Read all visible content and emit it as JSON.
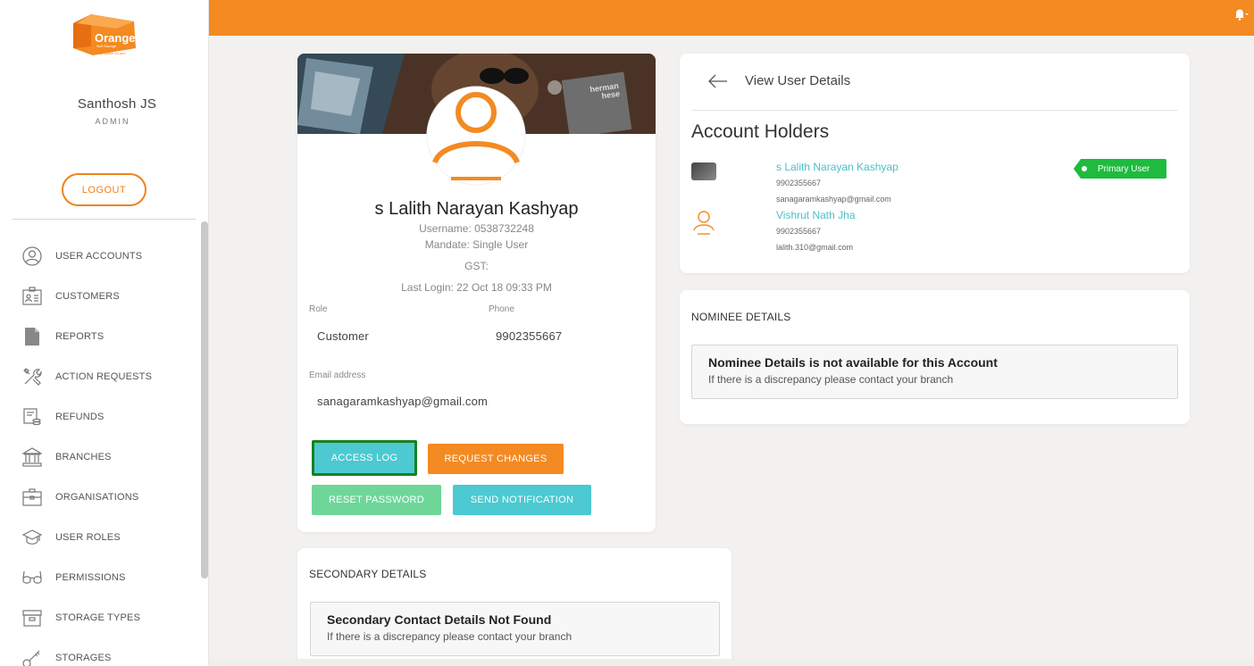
{
  "brand": {
    "logo_text": "Orange",
    "logo_sub": "Self Storage",
    "logo_tag": "Extra space for you",
    "accent": "#f38a22",
    "teal": "#4cc9d1",
    "green": "#1ebb3f"
  },
  "sidebar": {
    "user_name": "Santhosh JS",
    "user_role": "ADMIN",
    "logout_label": "LOGOUT",
    "items": [
      {
        "label": "USER ACCOUNTS",
        "icon": "user-circle-icon"
      },
      {
        "label": "CUSTOMERS",
        "icon": "id-card-icon"
      },
      {
        "label": "REPORTS",
        "icon": "document-icon"
      },
      {
        "label": "ACTION REQUESTS",
        "icon": "tools-icon"
      },
      {
        "label": "REFUNDS",
        "icon": "refund-icon"
      },
      {
        "label": "BRANCHES",
        "icon": "bank-icon"
      },
      {
        "label": "ORGANISATIONS",
        "icon": "briefcase-icon"
      },
      {
        "label": "USER ROLES",
        "icon": "graduation-cap-icon"
      },
      {
        "label": "PERMISSIONS",
        "icon": "glasses-icon"
      },
      {
        "label": "STORAGE TYPES",
        "icon": "archive-box-icon"
      },
      {
        "label": "STORAGES",
        "icon": "key-icon"
      }
    ]
  },
  "profile": {
    "name": "s Lalith Narayan Kashyap",
    "username": "Username: 0538732248",
    "mandate": "Mandate: Single User",
    "gst": "GST:",
    "last_login": "Last Login: 22 Oct 18 09:33 PM",
    "role_label": "Role",
    "role_value": "Customer",
    "phone_label": "Phone",
    "phone_value": "9902355667",
    "email_label": "Email address",
    "email_value": "sanagaramkashyap@gmail.com",
    "buttons": {
      "access_log": "ACCESS LOG",
      "request_changes": "REQUEST CHANGES",
      "reset_password": "RESET PASSWORD",
      "send_notification": "SEND NOTIFICATION"
    }
  },
  "details": {
    "title": "View User Details",
    "account_heading": "Account Holders",
    "holders": [
      {
        "name": "s Lalith Narayan Kashyap",
        "phone": "9902355667",
        "email": "sanagaramkashyap@gmail.com",
        "badge": "Primary User"
      },
      {
        "name": "Vishrut Nath Jha",
        "phone": "9902355667",
        "email": "lalith.310@gmail.com"
      }
    ]
  },
  "nominee": {
    "title": "NOMINEE DETAILS",
    "notice_title": "Nominee Details is not available for this Account",
    "notice_sub": "If there is a discrepancy please contact your branch"
  },
  "secondary": {
    "title": "SECONDARY DETAILS",
    "notice_title": "Secondary Contact Details Not Found",
    "notice_sub": "If there is a discrepancy please contact your branch"
  },
  "cover_book": {
    "line1": "herman",
    "line2": "hese"
  }
}
